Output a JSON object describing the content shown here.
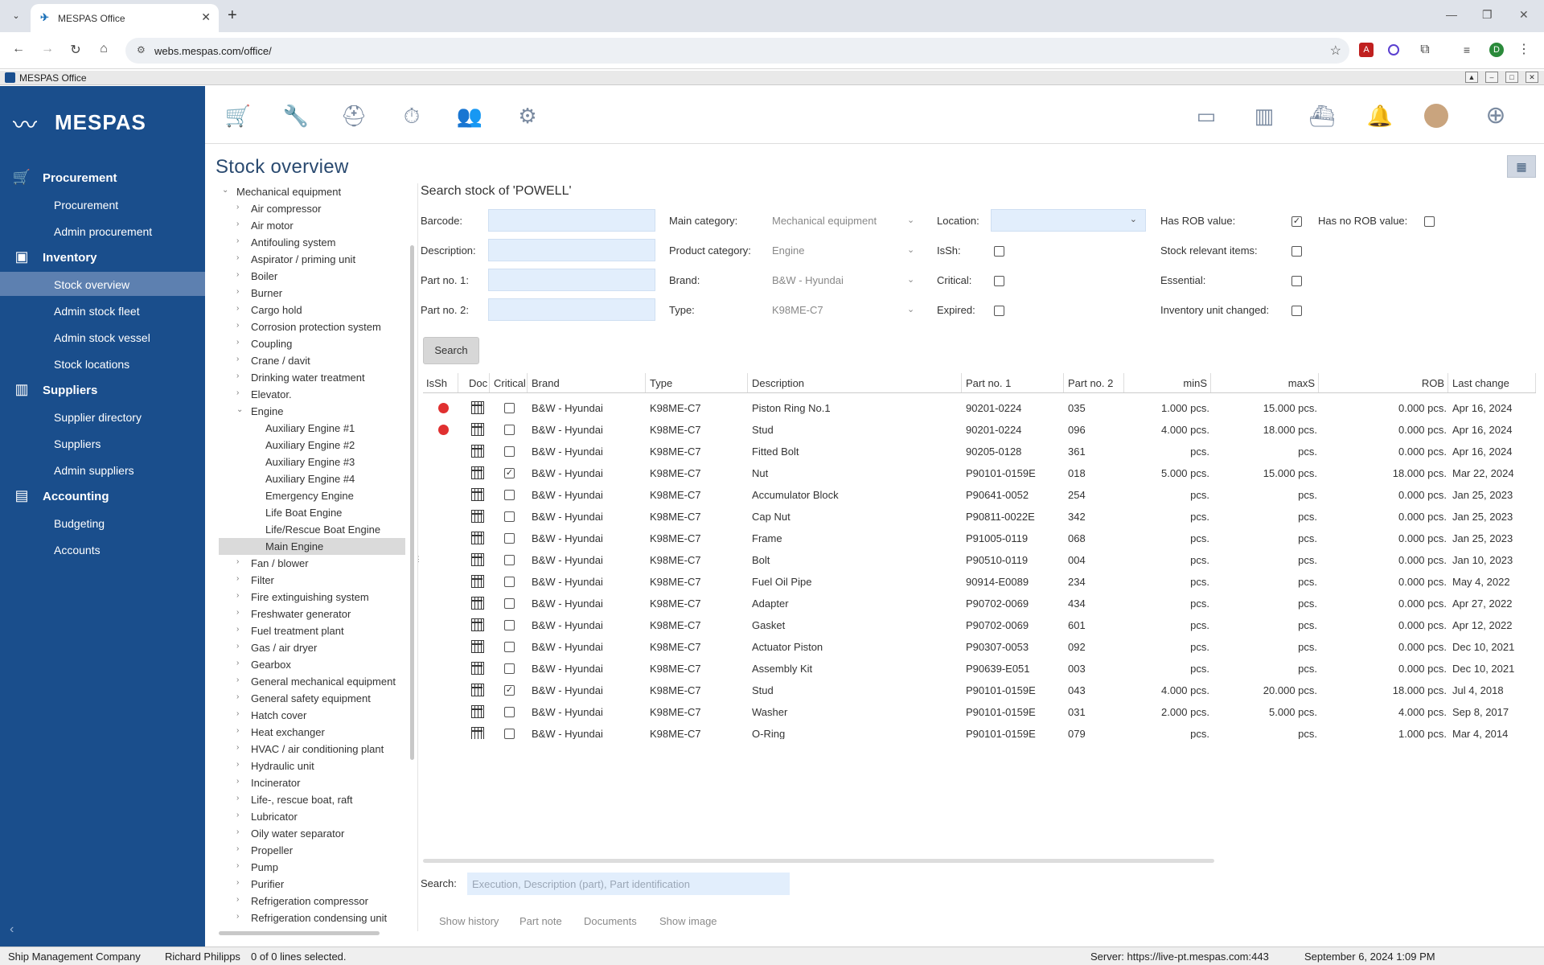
{
  "browser": {
    "tab_title": "MESPAS Office",
    "url": "webs.mespas.com/office/",
    "profile_initial": "D"
  },
  "app": {
    "window_title": "MESPAS Office",
    "brand": "MESPAS"
  },
  "sidebar": {
    "groups": [
      {
        "label": "Procurement",
        "icon": "cart-icon",
        "items": [
          "Procurement",
          "Admin procurement"
        ]
      },
      {
        "label": "Inventory",
        "icon": "boxes-icon",
        "items": [
          "Stock overview",
          "Admin stock fleet",
          "Admin stock vessel",
          "Stock locations"
        ]
      },
      {
        "label": "Suppliers",
        "icon": "buildings-icon",
        "items": [
          "Supplier directory",
          "Suppliers",
          "Admin suppliers"
        ]
      },
      {
        "label": "Accounting",
        "icon": "money-icon",
        "items": [
          "Budgeting",
          "Accounts"
        ]
      }
    ],
    "active": "Stock overview"
  },
  "page": {
    "title": "Stock overview",
    "search_header": "Search stock of 'POWELL'"
  },
  "tree": {
    "root": "Mechanical equipment",
    "children": [
      "Air compressor",
      "Air motor",
      "Antifouling system",
      "Aspirator / priming unit",
      "Boiler",
      "Burner",
      "Cargo hold",
      "Corrosion protection system",
      "Coupling",
      "Crane / davit",
      "Drinking water treatment",
      "Elevator.",
      "Engine"
    ],
    "engine_children": [
      "Auxiliary Engine #1",
      "Auxiliary Engine #2",
      "Auxiliary Engine #3",
      "Auxiliary Engine #4",
      "Emergency Engine",
      "Life Boat Engine",
      "Life/Rescue  Boat Engine",
      "Main Engine"
    ],
    "after": [
      "Fan / blower",
      "Filter",
      "Fire extinguishing system",
      "Freshwater generator",
      "Fuel treatment plant",
      "Gas / air dryer",
      "Gearbox",
      "General mechanical equipment",
      "General safety equipment",
      "Hatch cover",
      "Heat exchanger",
      "HVAC / air conditioning plant",
      "Hydraulic unit",
      "Incinerator",
      "Life-, rescue boat, raft",
      "Lubricator",
      "Oily water separator",
      "Propeller",
      "Pump",
      "Purifier",
      "Refrigeration compressor",
      "Refrigeration condensing unit"
    ],
    "selected": "Main Engine"
  },
  "form": {
    "barcode_label": "Barcode:",
    "description_label": "Description:",
    "part1_label": "Part no. 1:",
    "part2_label": "Part no. 2:",
    "main_category_label": "Main category:",
    "main_category_value": "Mechanical equipment",
    "product_category_label": "Product category:",
    "product_category_value": "Engine",
    "brand_label": "Brand:",
    "brand_value": "B&W - Hyundai",
    "type_label": "Type:",
    "type_value": "K98ME-C7",
    "location_label": "Location:",
    "issh_label": "IsSh:",
    "critical_label": "Critical:",
    "expired_label": "Expired:",
    "has_rob_label": "Has ROB value:",
    "has_no_rob_label": "Has no ROB value:",
    "stock_relevant_label": "Stock relevant items:",
    "essential_label": "Essential:",
    "inventory_unit_label": "Inventory unit changed:",
    "search_button": "Search"
  },
  "table": {
    "headers": [
      "IsSh",
      "Doc",
      "Critical",
      "Brand",
      "Type",
      "Description",
      "Part no. 1",
      "Part no. 2",
      "minS",
      "maxS",
      "ROB",
      "Last change"
    ],
    "rows": [
      {
        "issh": true,
        "critical": false,
        "brand": "B&W - Hyundai",
        "type": "K98ME-C7",
        "desc": "Piston Ring No.1",
        "p1": "90201-0224",
        "p2": "035",
        "min": "1.000 pcs.",
        "max": "15.000 pcs.",
        "rob": "0.000 pcs.",
        "date": "Apr 16, 2024"
      },
      {
        "issh": true,
        "critical": false,
        "brand": "B&W - Hyundai",
        "type": "K98ME-C7",
        "desc": "Stud",
        "p1": "90201-0224",
        "p2": "096",
        "min": "4.000 pcs.",
        "max": "18.000 pcs.",
        "rob": "0.000 pcs.",
        "date": "Apr 16, 2024"
      },
      {
        "issh": false,
        "critical": false,
        "brand": "B&W - Hyundai",
        "type": "K98ME-C7",
        "desc": "Fitted Bolt",
        "p1": "90205-0128",
        "p2": "361",
        "min": "pcs.",
        "max": "pcs.",
        "rob": "0.000 pcs.",
        "date": "Apr 16, 2024"
      },
      {
        "issh": false,
        "critical": true,
        "brand": "B&W - Hyundai",
        "type": "K98ME-C7",
        "desc": "Nut",
        "p1": "P90101-0159E",
        "p2": "018",
        "min": "5.000 pcs.",
        "max": "15.000 pcs.",
        "rob": "18.000 pcs.",
        "date": "Mar 22, 2024"
      },
      {
        "issh": false,
        "critical": false,
        "brand": "B&W - Hyundai",
        "type": "K98ME-C7",
        "desc": "Accumulator Block",
        "p1": "P90641-0052",
        "p2": "254",
        "min": "pcs.",
        "max": "pcs.",
        "rob": "0.000 pcs.",
        "date": "Jan 25, 2023"
      },
      {
        "issh": false,
        "critical": false,
        "brand": "B&W - Hyundai",
        "type": "K98ME-C7",
        "desc": "Cap Nut",
        "p1": "P90811-0022E",
        "p2": "342",
        "min": "pcs.",
        "max": "pcs.",
        "rob": "0.000 pcs.",
        "date": "Jan 25, 2023"
      },
      {
        "issh": false,
        "critical": false,
        "brand": "B&W - Hyundai",
        "type": "K98ME-C7",
        "desc": "Frame",
        "p1": "P91005-0119",
        "p2": "068",
        "min": "pcs.",
        "max": "pcs.",
        "rob": "0.000 pcs.",
        "date": "Jan 25, 2023"
      },
      {
        "issh": false,
        "critical": false,
        "brand": "B&W - Hyundai",
        "type": "K98ME-C7",
        "desc": "Bolt",
        "p1": "P90510-0119",
        "p2": "004",
        "min": "pcs.",
        "max": "pcs.",
        "rob": "0.000 pcs.",
        "date": "Jan 10, 2023"
      },
      {
        "issh": false,
        "critical": false,
        "brand": "B&W - Hyundai",
        "type": "K98ME-C7",
        "desc": "Fuel Oil Pipe",
        "p1": "90914-E0089",
        "p2": "234",
        "min": "pcs.",
        "max": "pcs.",
        "rob": "0.000 pcs.",
        "date": "May 4, 2022"
      },
      {
        "issh": false,
        "critical": false,
        "brand": "B&W - Hyundai",
        "type": "K98ME-C7",
        "desc": "Adapter",
        "p1": "P90702-0069",
        "p2": "434",
        "min": "pcs.",
        "max": "pcs.",
        "rob": "0.000 pcs.",
        "date": "Apr 27, 2022"
      },
      {
        "issh": false,
        "critical": false,
        "brand": "B&W - Hyundai",
        "type": "K98ME-C7",
        "desc": "Gasket",
        "p1": "P90702-0069",
        "p2": "601",
        "min": "pcs.",
        "max": "pcs.",
        "rob": "0.000 pcs.",
        "date": "Apr 12, 2022"
      },
      {
        "issh": false,
        "critical": false,
        "brand": "B&W - Hyundai",
        "type": "K98ME-C7",
        "desc": "Actuator Piston",
        "p1": "P90307-0053",
        "p2": "092",
        "min": "pcs.",
        "max": "pcs.",
        "rob": "0.000 pcs.",
        "date": "Dec 10, 2021"
      },
      {
        "issh": false,
        "critical": false,
        "brand": "B&W - Hyundai",
        "type": "K98ME-C7",
        "desc": "Assembly Kit",
        "p1": "P90639-E051",
        "p2": "003",
        "min": "pcs.",
        "max": "pcs.",
        "rob": "0.000 pcs.",
        "date": "Dec 10, 2021"
      },
      {
        "issh": false,
        "critical": true,
        "brand": "B&W - Hyundai",
        "type": "K98ME-C7",
        "desc": "Stud",
        "p1": "P90101-0159E",
        "p2": "043",
        "min": "4.000 pcs.",
        "max": "20.000 pcs.",
        "rob": "18.000 pcs.",
        "date": "Jul 4, 2018"
      },
      {
        "issh": false,
        "critical": false,
        "brand": "B&W - Hyundai",
        "type": "K98ME-C7",
        "desc": "Washer",
        "p1": "P90101-0159E",
        "p2": "031",
        "min": "2.000 pcs.",
        "max": "5.000 pcs.",
        "rob": "4.000 pcs.",
        "date": "Sep 8, 2017"
      },
      {
        "issh": false,
        "critical": false,
        "brand": "B&W - Hyundai",
        "type": "K98ME-C7",
        "desc": "O-Ring",
        "p1": "P90101-0159E",
        "p2": "079",
        "min": "pcs.",
        "max": "pcs.",
        "rob": "1.000 pcs.",
        "date": "Mar 4, 2014"
      }
    ]
  },
  "bottom": {
    "search_label": "Search:",
    "search_placeholder": "Execution, Description (part), Part identification",
    "links": [
      "Show history",
      "Part note",
      "Documents",
      "Show image"
    ]
  },
  "status": {
    "company": "Ship Management Company",
    "user": "Richard Philipps",
    "selection": "0 of 0 lines selected.",
    "server": "Server: https://live-pt.mespas.com:443",
    "datetime": "September 6, 2024 1:09 PM"
  }
}
